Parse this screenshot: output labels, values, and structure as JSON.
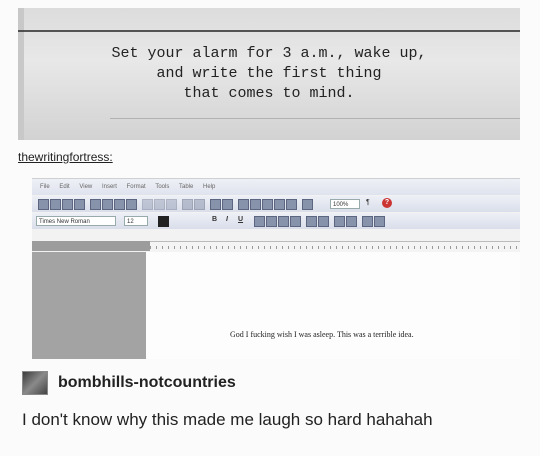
{
  "photo": {
    "quote_lines": [
      "Set your alarm for 3 a.m., wake up,",
      "and write the first thing",
      "that comes to mind."
    ]
  },
  "source_author": "thewritingfortress:",
  "word_processor": {
    "menu": [
      "File",
      "Edit",
      "View",
      "Insert",
      "Format",
      "Tools",
      "Table",
      "Help"
    ],
    "font_name": "Times New Roman",
    "font_size": "12",
    "zoom": "100%",
    "bold": "B",
    "italic": "I",
    "underline": "U",
    "document_text": "God I fucking wish I was asleep. This was a terrible idea."
  },
  "reblog": {
    "username": "bombhills-notcountries",
    "comment": "I don't know why this made me laugh so hard hahahah"
  }
}
